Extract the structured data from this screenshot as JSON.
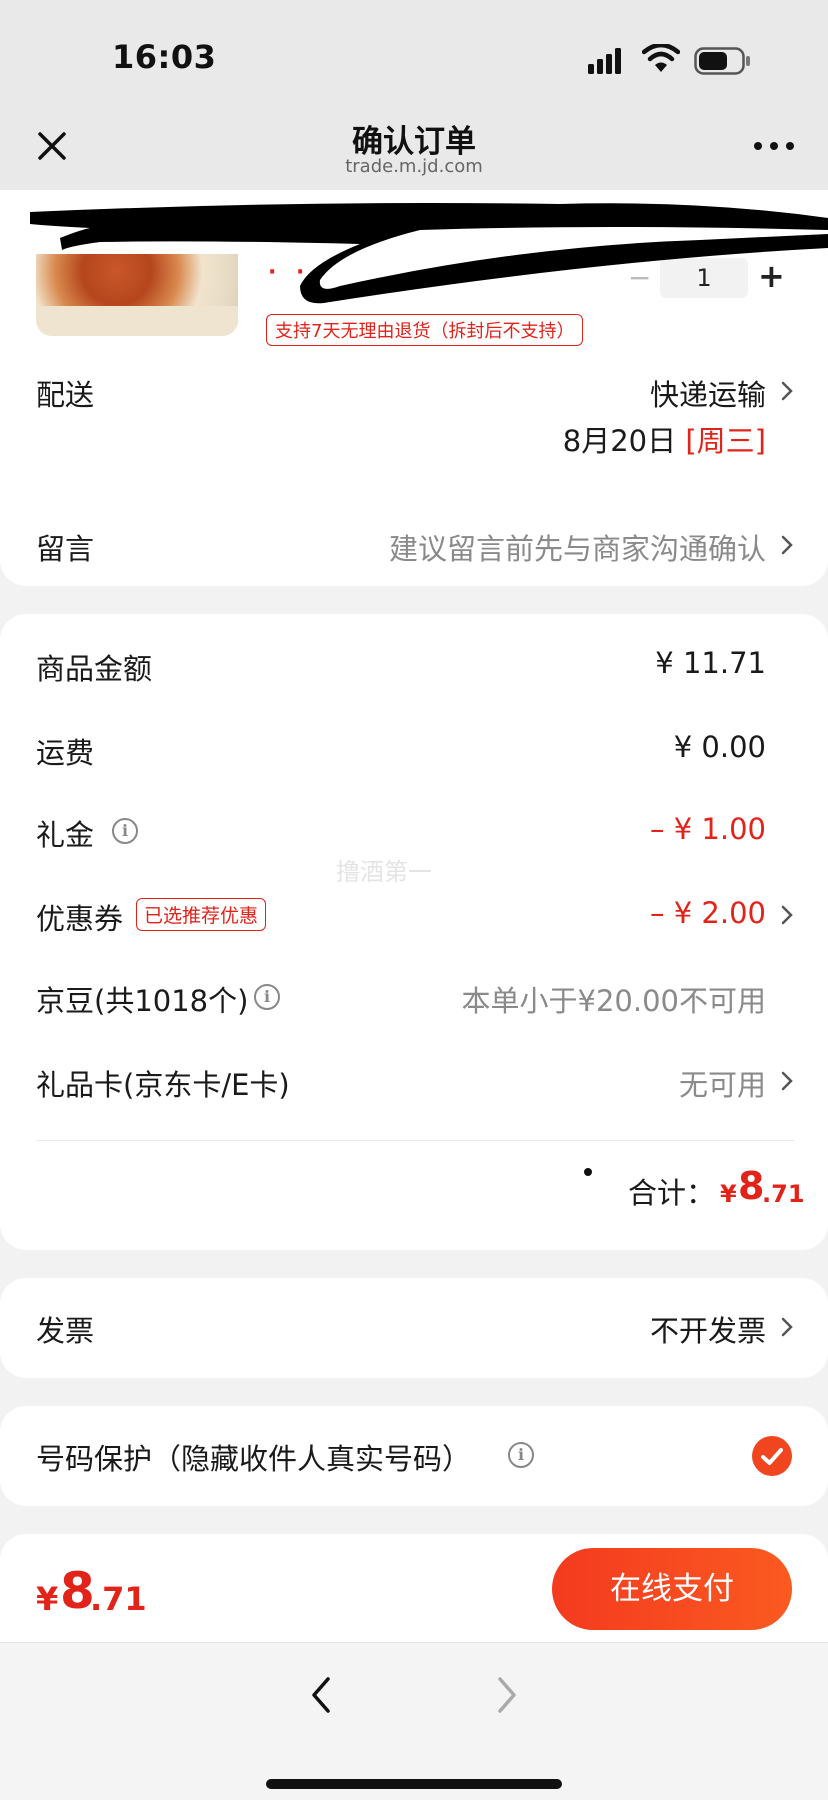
{
  "status_bar": {
    "time": "16:03"
  },
  "nav": {
    "title": "确认订单",
    "subtitle": "trade.m.jd.com"
  },
  "product": {
    "quantity": "1",
    "minus": "−",
    "plus": "+",
    "return_tag": "支持7天无理由退货（拆封后不支持）"
  },
  "delivery": {
    "label": "配送",
    "method": "快递运输",
    "date": "8月20日",
    "weekday": "[周三]"
  },
  "message": {
    "label": "留言",
    "placeholder": "建议留言前先与商家沟通确认"
  },
  "summary": {
    "goods_label": "商品金额",
    "goods_value": "¥ 11.71",
    "shipping_label": "运费",
    "shipping_value": "¥ 0.00",
    "giftcash_label": "礼金",
    "giftcash_value": "– ¥ 1.00",
    "coupon_label": "优惠券",
    "coupon_tag": "已选推荐优惠",
    "coupon_value": "– ¥ 2.00",
    "beans_label": "京豆(共1018个)",
    "beans_value": "本单小于¥20.00不可用",
    "giftcard_label": "礼品卡(京东卡/E卡)",
    "giftcard_value": "无可用",
    "watermark": "撸酒第一",
    "total_label": "合计：",
    "total_currency": "¥",
    "total_int": "8",
    "total_dec": ".71"
  },
  "invoice": {
    "label": "发票",
    "value": "不开发票"
  },
  "privacy": {
    "label": "号码保护（隐藏收件人真实号码）",
    "checked": true
  },
  "paybar": {
    "currency": "¥",
    "amount_int": "8",
    "amount_dec": ".71",
    "pay_button": "在线支付"
  },
  "colors": {
    "accent_red": "#e2231a",
    "pay_orange": "#f0451f"
  }
}
